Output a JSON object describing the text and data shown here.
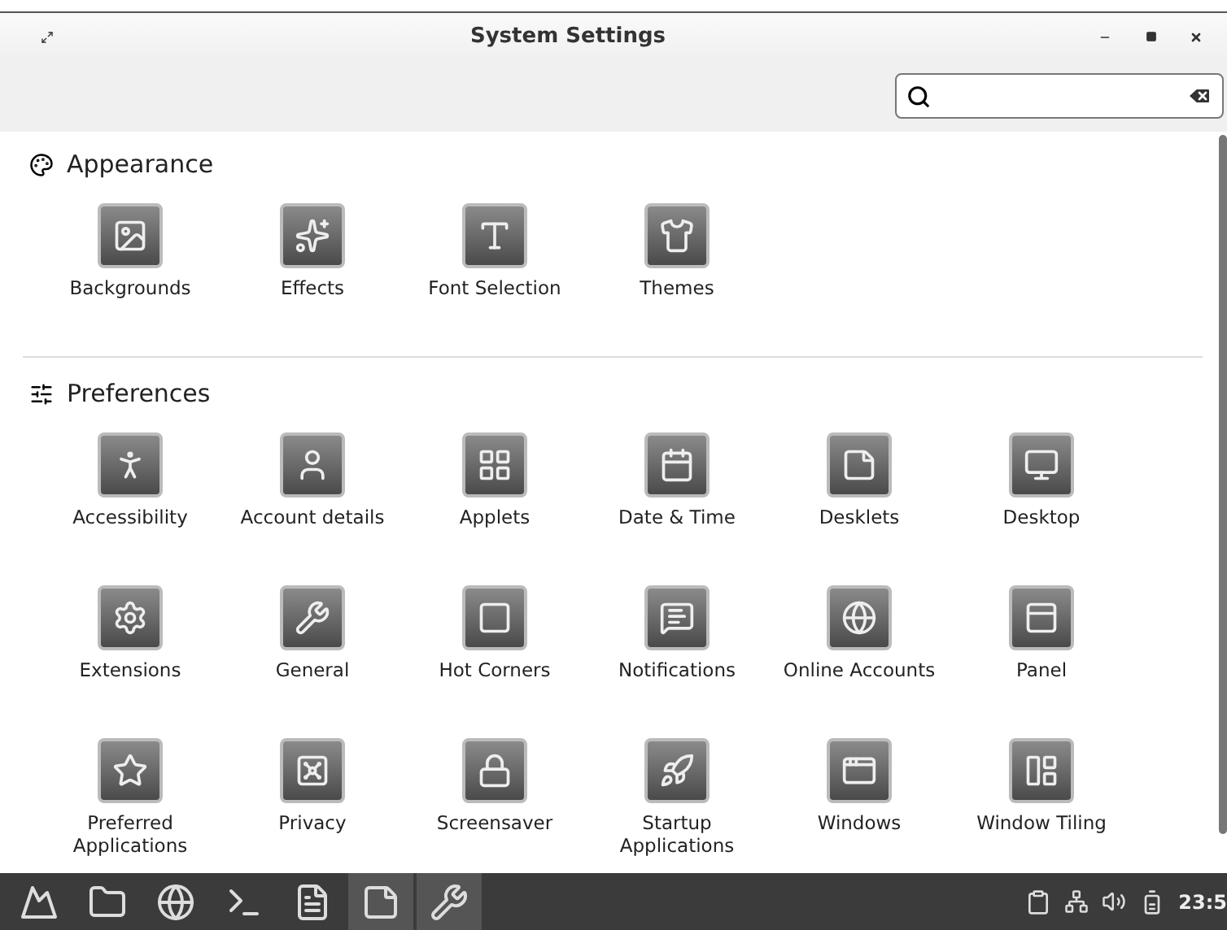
{
  "window": {
    "title": "System Settings"
  },
  "sections": [
    {
      "title": "Appearance",
      "items": [
        {
          "label": "Backgrounds"
        },
        {
          "label": "Effects"
        },
        {
          "label": "Font Selection"
        },
        {
          "label": "Themes"
        }
      ]
    },
    {
      "title": "Preferences",
      "items": [
        {
          "label": "Accessibility"
        },
        {
          "label": "Account details"
        },
        {
          "label": "Applets"
        },
        {
          "label": "Date & Time"
        },
        {
          "label": "Desklets"
        },
        {
          "label": "Desktop"
        },
        {
          "label": "Extensions"
        },
        {
          "label": "General"
        },
        {
          "label": "Hot Corners"
        },
        {
          "label": "Notifications"
        },
        {
          "label": "Online Accounts"
        },
        {
          "label": "Panel"
        },
        {
          "label": "Preferred Applications"
        },
        {
          "label": "Privacy"
        },
        {
          "label": "Screensaver"
        },
        {
          "label": "Startup Applications"
        },
        {
          "label": "Windows"
        },
        {
          "label": "Window Tiling"
        }
      ]
    }
  ],
  "taskbar": {
    "launchers": [
      {
        "selected": false
      },
      {
        "selected": false
      },
      {
        "selected": false
      },
      {
        "selected": false
      },
      {
        "selected": false
      },
      {
        "selected": true
      },
      {
        "selected": true
      }
    ],
    "clock": "23:5"
  }
}
